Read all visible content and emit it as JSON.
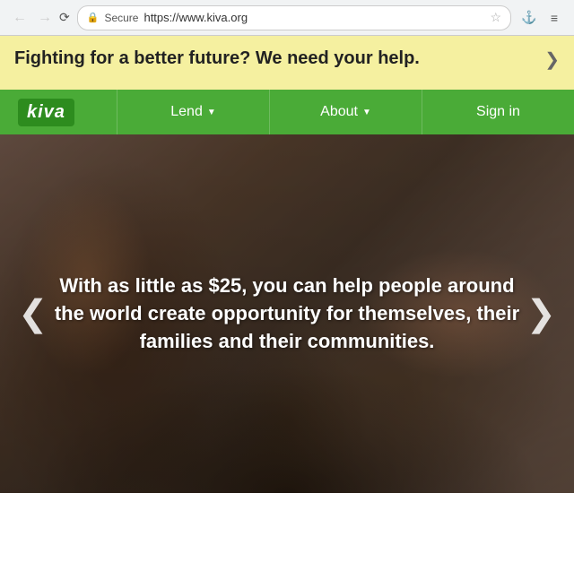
{
  "browser": {
    "back_disabled": true,
    "forward_disabled": true,
    "secure_label": "Secure",
    "url": "https://www.kiva.org",
    "star_icon": "★"
  },
  "banner": {
    "text": "Fighting for a better future? We need your help.",
    "close_icon": "❯"
  },
  "navbar": {
    "logo": "kiva",
    "items": [
      {
        "label": "Lend",
        "has_arrow": true
      },
      {
        "label": "About",
        "has_arrow": true
      },
      {
        "label": "Sign in",
        "has_arrow": false
      }
    ]
  },
  "hero": {
    "text": "With as little as $25, you can help people around the world create opportunity for themselves, their families and their communities.",
    "prev_icon": "❮",
    "next_icon": "❯"
  }
}
